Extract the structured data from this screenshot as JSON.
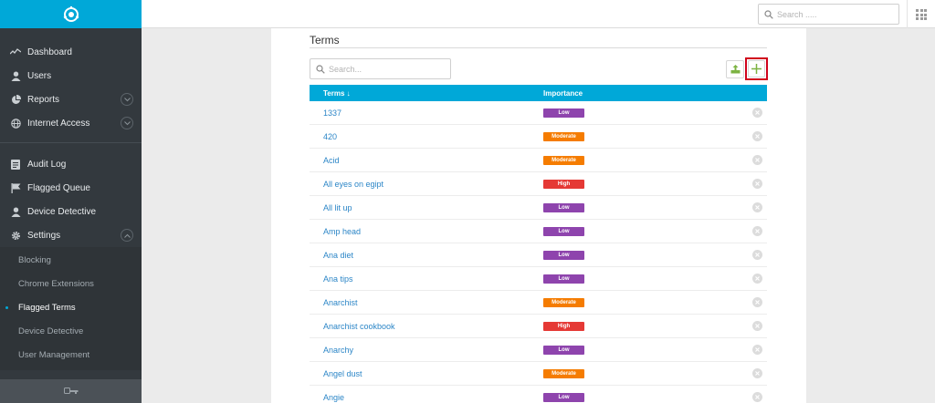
{
  "sidebar": {
    "nav_top": [
      {
        "label": "Dashboard",
        "icon": "activity-icon",
        "expandable": false
      },
      {
        "label": "Users",
        "icon": "user-icon",
        "expandable": false
      },
      {
        "label": "Reports",
        "icon": "pie-chart-icon",
        "expandable": true
      },
      {
        "label": "Internet Access",
        "icon": "globe-icon",
        "expandable": true
      }
    ],
    "nav_bottom": [
      {
        "label": "Audit Log",
        "icon": "log-icon"
      },
      {
        "label": "Flagged Queue",
        "icon": "flag-icon"
      },
      {
        "label": "Device Detective",
        "icon": "user-icon"
      },
      {
        "label": "Settings",
        "icon": "gear-icon"
      }
    ],
    "settings_sub": [
      "Blocking",
      "Chrome Extensions",
      "Flagged Terms",
      "Device Detective",
      "User Management"
    ],
    "active_sub": "Flagged Terms"
  },
  "topbar": {
    "search_placeholder": "Search ....."
  },
  "panel": {
    "title": "Terms",
    "search_placeholder": "Search...",
    "columns": {
      "terms": "Terms",
      "sort_arrow": "↓",
      "importance": "Importance"
    },
    "rows": [
      {
        "term": "1337",
        "importance": "Low"
      },
      {
        "term": "420",
        "importance": "Moderate"
      },
      {
        "term": "Acid",
        "importance": "Moderate"
      },
      {
        "term": "All eyes on egipt",
        "importance": "High"
      },
      {
        "term": "All lit up",
        "importance": "Low"
      },
      {
        "term": "Amp head",
        "importance": "Low"
      },
      {
        "term": "Ana diet",
        "importance": "Low"
      },
      {
        "term": "Ana tips",
        "importance": "Low"
      },
      {
        "term": "Anarchist",
        "importance": "Moderate"
      },
      {
        "term": "Anarchist cookbook",
        "importance": "High"
      },
      {
        "term": "Anarchy",
        "importance": "Low"
      },
      {
        "term": "Angel dust",
        "importance": "Moderate"
      },
      {
        "term": "Angie",
        "importance": "Low"
      }
    ]
  },
  "colors": {
    "accent": "#00a8d8",
    "Low": "#8e44ad",
    "Moderate": "#f57c00",
    "High": "#e53935",
    "highlight": "#d0021b"
  }
}
